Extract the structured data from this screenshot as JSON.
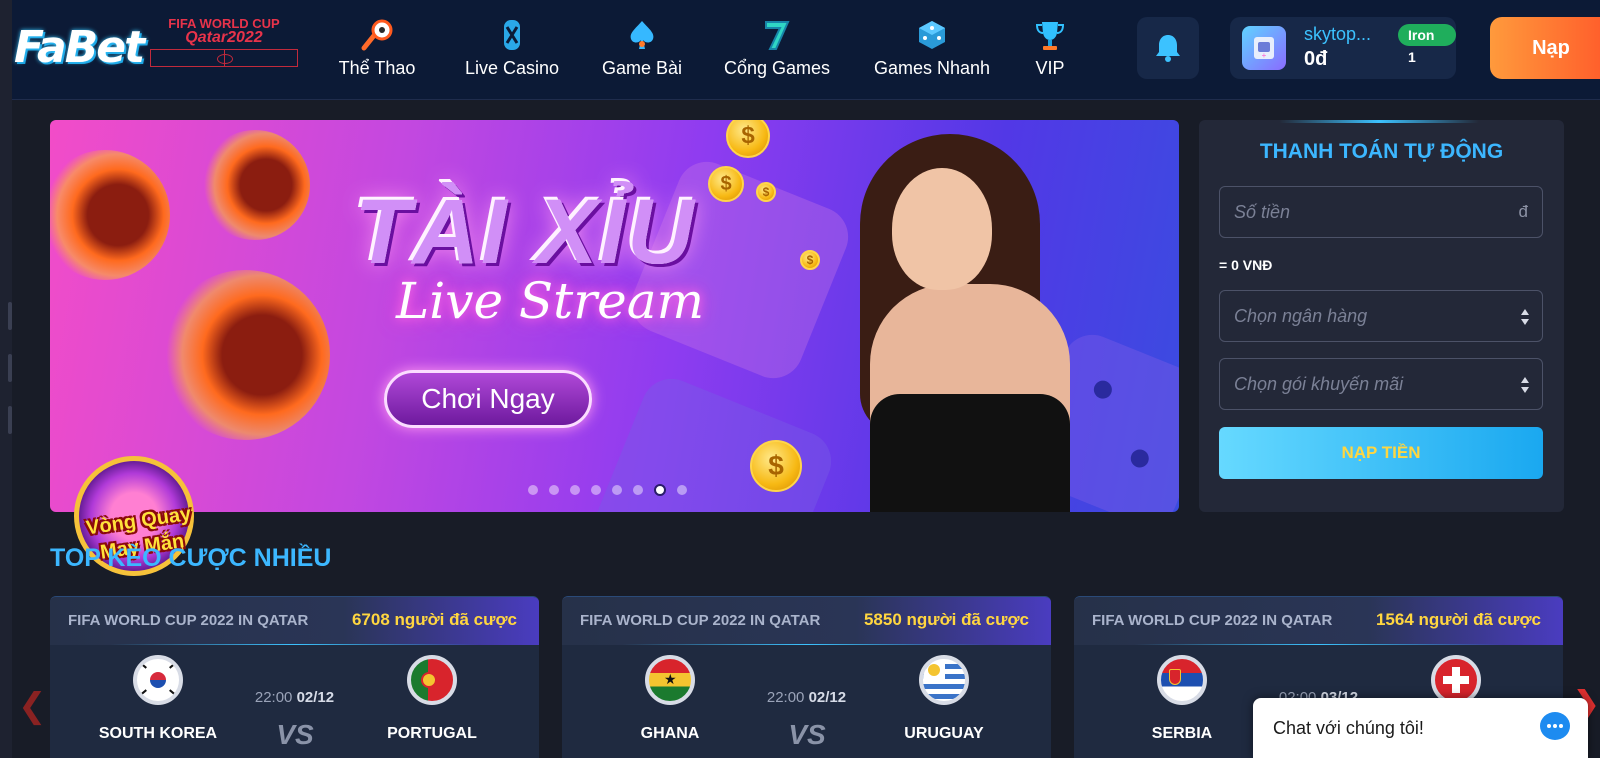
{
  "header": {
    "logo": "FaBet",
    "world_cup_badge": {
      "line1": "FIFA WORLD CUP",
      "line2": "Qatar2022"
    },
    "nav": [
      {
        "label": "Thể Thao",
        "icon": "soccer-ball-icon"
      },
      {
        "label": "Live Casino",
        "icon": "casino-chip-icon"
      },
      {
        "label": "Game Bài",
        "icon": "spade-card-icon"
      },
      {
        "label": "Cổng Games",
        "icon": "lucky-seven-icon"
      },
      {
        "label": "Games Nhanh",
        "icon": "dice-icon"
      },
      {
        "label": "VIP",
        "icon": "trophy-icon"
      }
    ],
    "user": {
      "name": "skytop...",
      "balance": "0đ",
      "rank": "Iron 1"
    },
    "deposit_button": "Nạp"
  },
  "banner": {
    "title": "TÀI XỈU",
    "subtitle": "Live Stream",
    "cta": "Chơi Ngay",
    "slide_count": 8,
    "active_slide": 7
  },
  "lucky_wheel": {
    "line1": "Vòng Quay",
    "line2": "May Mắn"
  },
  "payment": {
    "title": "THANH TOÁN TỰ ĐỘNG",
    "amount_placeholder": "Số tiền",
    "currency_symbol": "đ",
    "equivalent": "= 0 VNĐ",
    "bank_placeholder": "Chọn ngân hàng",
    "promo_placeholder": "Chọn gói khuyến mãi",
    "submit": "NẠP TIỀN"
  },
  "section": {
    "title": "TOP KÈO CƯỢC NHIỀU"
  },
  "matches": [
    {
      "league": "FIFA WORLD CUP 2022 IN QATAR",
      "bettors": "6708 người đã cược",
      "home": "SOUTH KOREA",
      "away": "PORTUGAL",
      "time": "22:00",
      "date": "02/12",
      "vs": "VS"
    },
    {
      "league": "FIFA WORLD CUP 2022 IN QATAR",
      "bettors": "5850 người đã cược",
      "home": "GHANA",
      "away": "URUGUAY",
      "time": "22:00",
      "date": "02/12",
      "vs": "VS"
    },
    {
      "league": "FIFA WORLD CUP 2022 IN QATAR",
      "bettors": "1564 người đã cược",
      "home": "SERBIA",
      "away": "",
      "time": "02:00",
      "date": "03/12",
      "vs": ""
    }
  ],
  "chat": {
    "label": "Chat với chúng tôi!"
  },
  "colors": {
    "accent": "#3cb7ff",
    "gold": "#ffd640",
    "header_bg": "#0c1a36",
    "panel_bg": "#232838",
    "deposit_orange": "#ff7a30"
  }
}
